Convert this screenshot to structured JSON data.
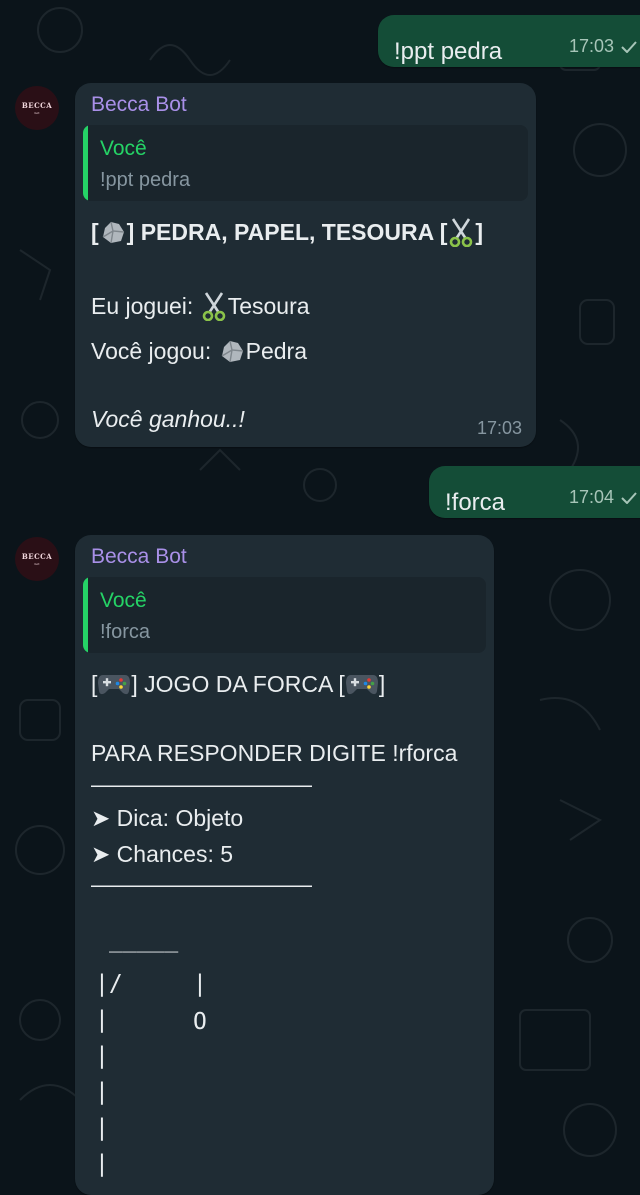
{
  "colors": {
    "background": "#0b141a",
    "outgoing_bubble": "#144d37",
    "incoming_bubble": "#1f2c34",
    "sender_name": "#a990e8",
    "quote_accent": "#25d366",
    "meta_text": "#8696a0"
  },
  "messages": [
    {
      "direction": "outgoing",
      "text": "!ppt pedra",
      "time": "17:03",
      "status_icon": "single-check-icon"
    },
    {
      "direction": "incoming",
      "sender": "Becca Bot",
      "avatar_text": "BECCA",
      "avatar_subtext": "bot",
      "quote": {
        "author": "Você",
        "text": "!ppt pedra"
      },
      "title": {
        "open": "[",
        "middle": "] PEDRA, PAPEL, TESOURA [",
        "close": "]",
        "left_icon": "rock-icon",
        "right_icon": "scissors-icon"
      },
      "line_me_label": "Eu joguei:",
      "line_me_icon": "scissors-icon",
      "line_me_value": "Tesoura",
      "line_you_label": "Você jogou:",
      "line_you_icon": "rock-icon",
      "line_you_value": "Pedra",
      "result": "Você ganhou..!",
      "time": "17:03"
    },
    {
      "direction": "outgoing",
      "text": "!forca",
      "time": "17:04",
      "status_icon": "single-check-icon"
    },
    {
      "direction": "incoming",
      "sender": "Becca Bot",
      "avatar_text": "BECCA",
      "avatar_subtext": "bot",
      "quote": {
        "author": "Você",
        "text": "!forca"
      },
      "title": {
        "open": "[",
        "middle": "] JOGO DA FORCA [",
        "close": "]",
        "left_icon": "gamepad-icon",
        "right_icon": "gamepad-icon"
      },
      "instruction": "PARA RESPONDER DIGITE !rforca",
      "separator": "——————————",
      "hint": "➤ Dica: Objeto",
      "chances": "➤ Chances: 5",
      "gallows": {
        "top": "_____",
        "row1_left": "|/",
        "row1_right": "|",
        "row2_left": "|",
        "row2_right": "O",
        "post": "|"
      }
    }
  ]
}
